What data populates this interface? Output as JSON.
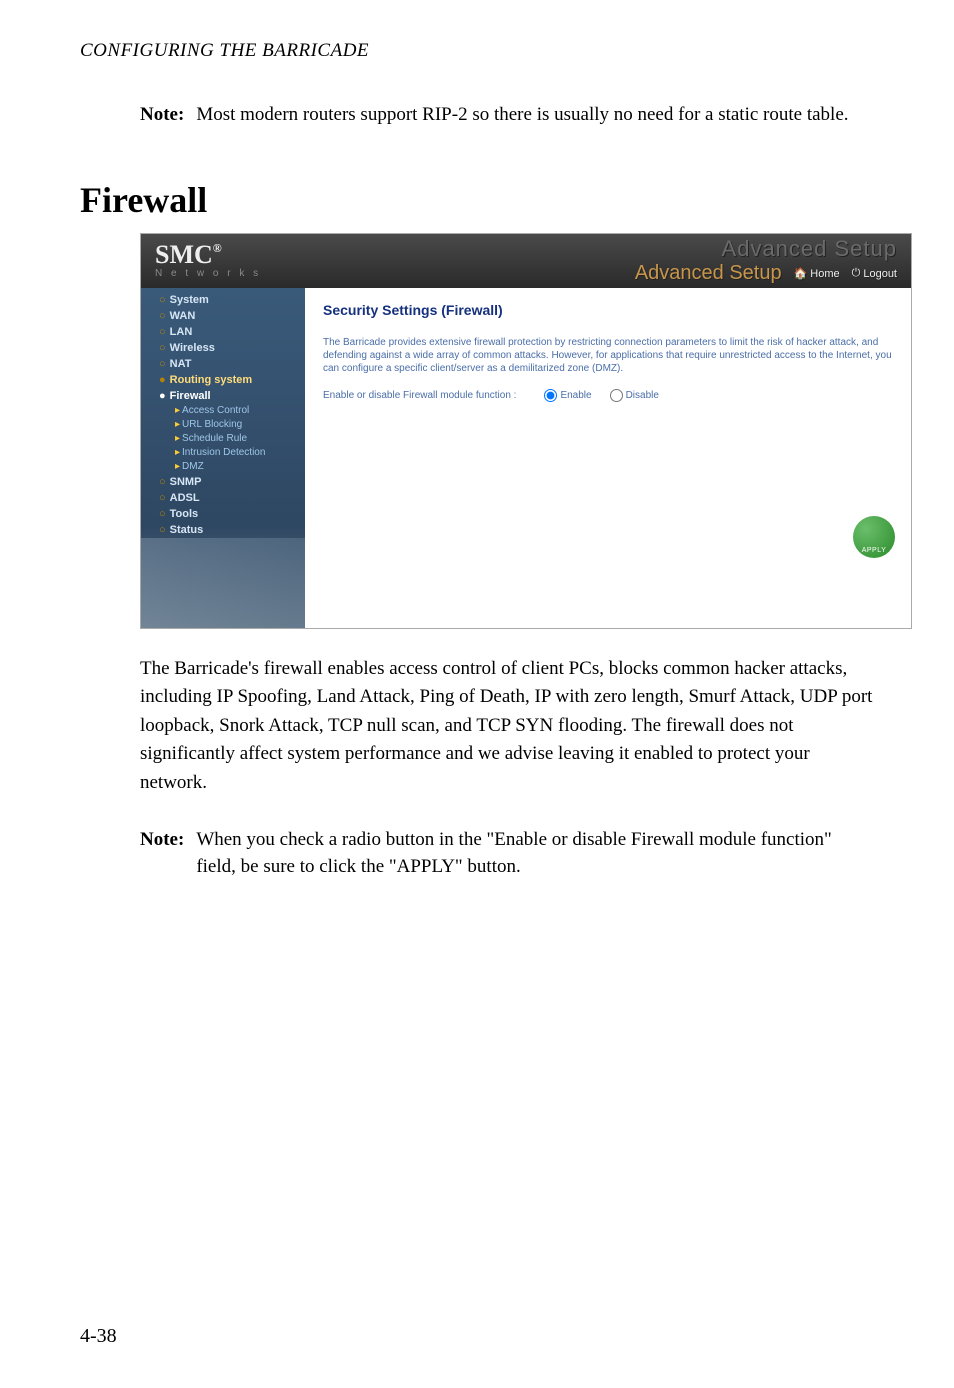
{
  "running_head": "CONFIGURING THE BARRICADE",
  "note1": {
    "label": "Note:",
    "text": "Most modern routers support RIP-2 so there is usually no need for a static route table."
  },
  "heading": "Firewall",
  "screenshot": {
    "logo_main": "SMC",
    "logo_reg": "®",
    "logo_sub": "N e t w o r k s",
    "banner_ghost": "Advanced Setup",
    "setup_label": "Advanced Setup",
    "home": "Home",
    "logout": "Logout",
    "sidebar": {
      "items": [
        {
          "label": "System"
        },
        {
          "label": "WAN"
        },
        {
          "label": "LAN"
        },
        {
          "label": "Wireless"
        },
        {
          "label": "NAT"
        },
        {
          "label": "Routing system"
        },
        {
          "label": "Firewall"
        },
        {
          "label": "SNMP"
        },
        {
          "label": "ADSL"
        },
        {
          "label": "Tools"
        },
        {
          "label": "Status"
        }
      ],
      "firewall_subs": [
        "Access Control",
        "URL Blocking",
        "Schedule Rule",
        "Intrusion Detection",
        "DMZ"
      ]
    },
    "main": {
      "title": "Security Settings (Firewall)",
      "para": "The Barricade provides extensive firewall protection by restricting connection parameters to limit the risk of hacker attack, and defending against a wide array of common attacks. However, for applications that require unrestricted access to the Internet, you can configure a specific client/server as a demilitarized zone (DMZ).",
      "radio_label": "Enable or disable Firewall module function :",
      "enable": "Enable",
      "disable": "Disable",
      "apply": "APPLY"
    }
  },
  "body_para": "The Barricade's firewall enables access control of client PCs, blocks common hacker attacks, including IP Spoofing, Land Attack, Ping of Death, IP with zero length, Smurf Attack, UDP port loopback, Snork Attack, TCP null scan, and TCP SYN flooding. The firewall does not significantly affect system performance and we advise leaving it enabled to protect your network.",
  "note2": {
    "label": "Note:",
    "text": "When you check a radio button in the \"Enable or disable Firewall module function\" field, be sure to click the \"APPLY\" button."
  },
  "page_number": "4-38"
}
